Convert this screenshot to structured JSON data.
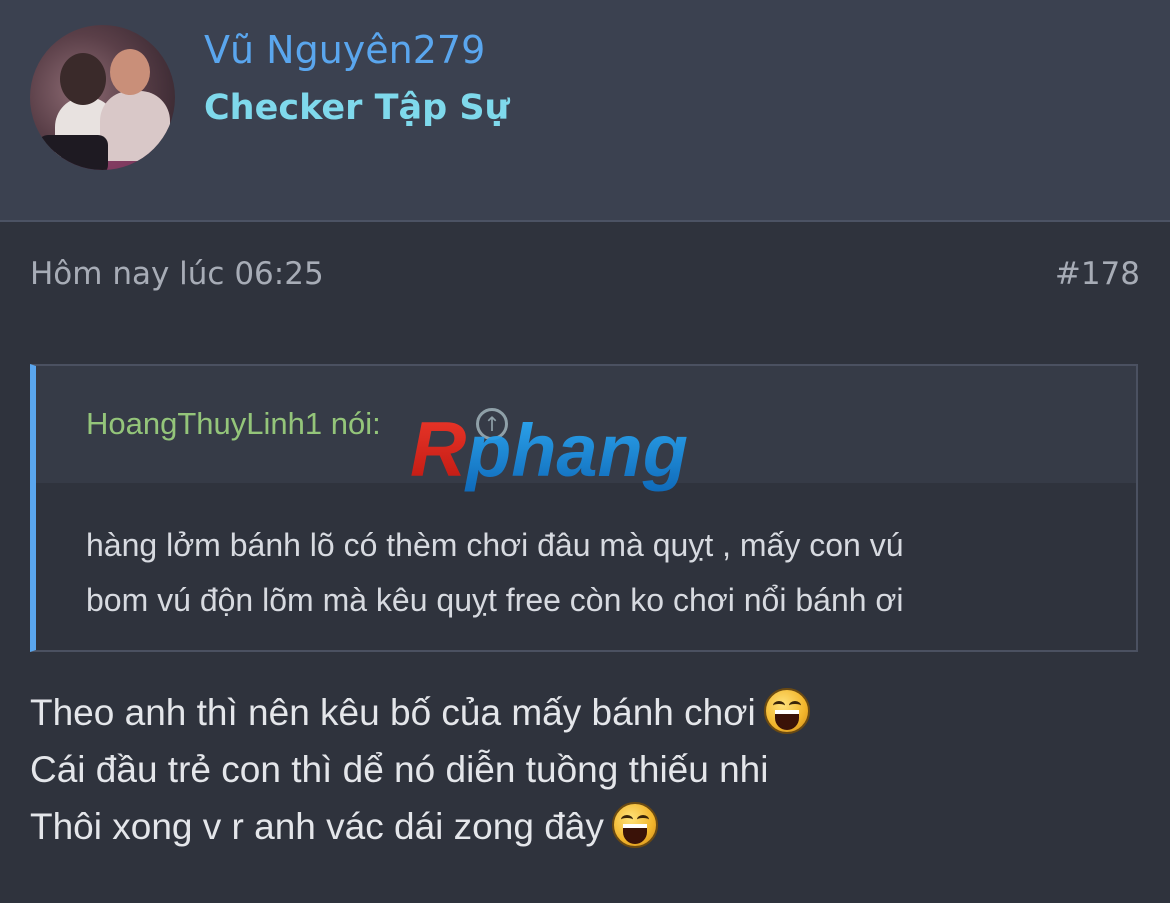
{
  "header": {
    "username": "Vũ Nguyên279",
    "user_title": "Checker Tập Sự",
    "avatar_icon": "user-avatar-photo"
  },
  "post": {
    "timestamp": "Hôm nay lúc 06:25",
    "post_number": "#178",
    "quote": {
      "author_line": "HoangThuyLinh1 nói:",
      "jump_icon": "arrow-up-circle-icon",
      "text_lines": [
        "hàng lởm bánh lõ có thèm chơi đâu mà quỵt , mấy con vú",
        "bom vú độn lõm mà kêu quỵt free còn ko chơi nổi bánh ơi"
      ]
    },
    "body_lines": [
      "Theo anh thì nên kêu bố của mấy bánh chơi",
      "Cái đầu trẻ con thì dể nó diễn tuồng thiếu nhi",
      "Thôi xong v r anh vác dái zong đây"
    ],
    "emoji_icon": "laughing-smiley-icon"
  },
  "watermark": {
    "text": "Rphang"
  },
  "colors": {
    "background": "#2f333d",
    "username": "#5aa6ee",
    "user_title": "#7fd9ec",
    "quote_author": "#94c57a",
    "quote_border": "#5aa6ee"
  }
}
